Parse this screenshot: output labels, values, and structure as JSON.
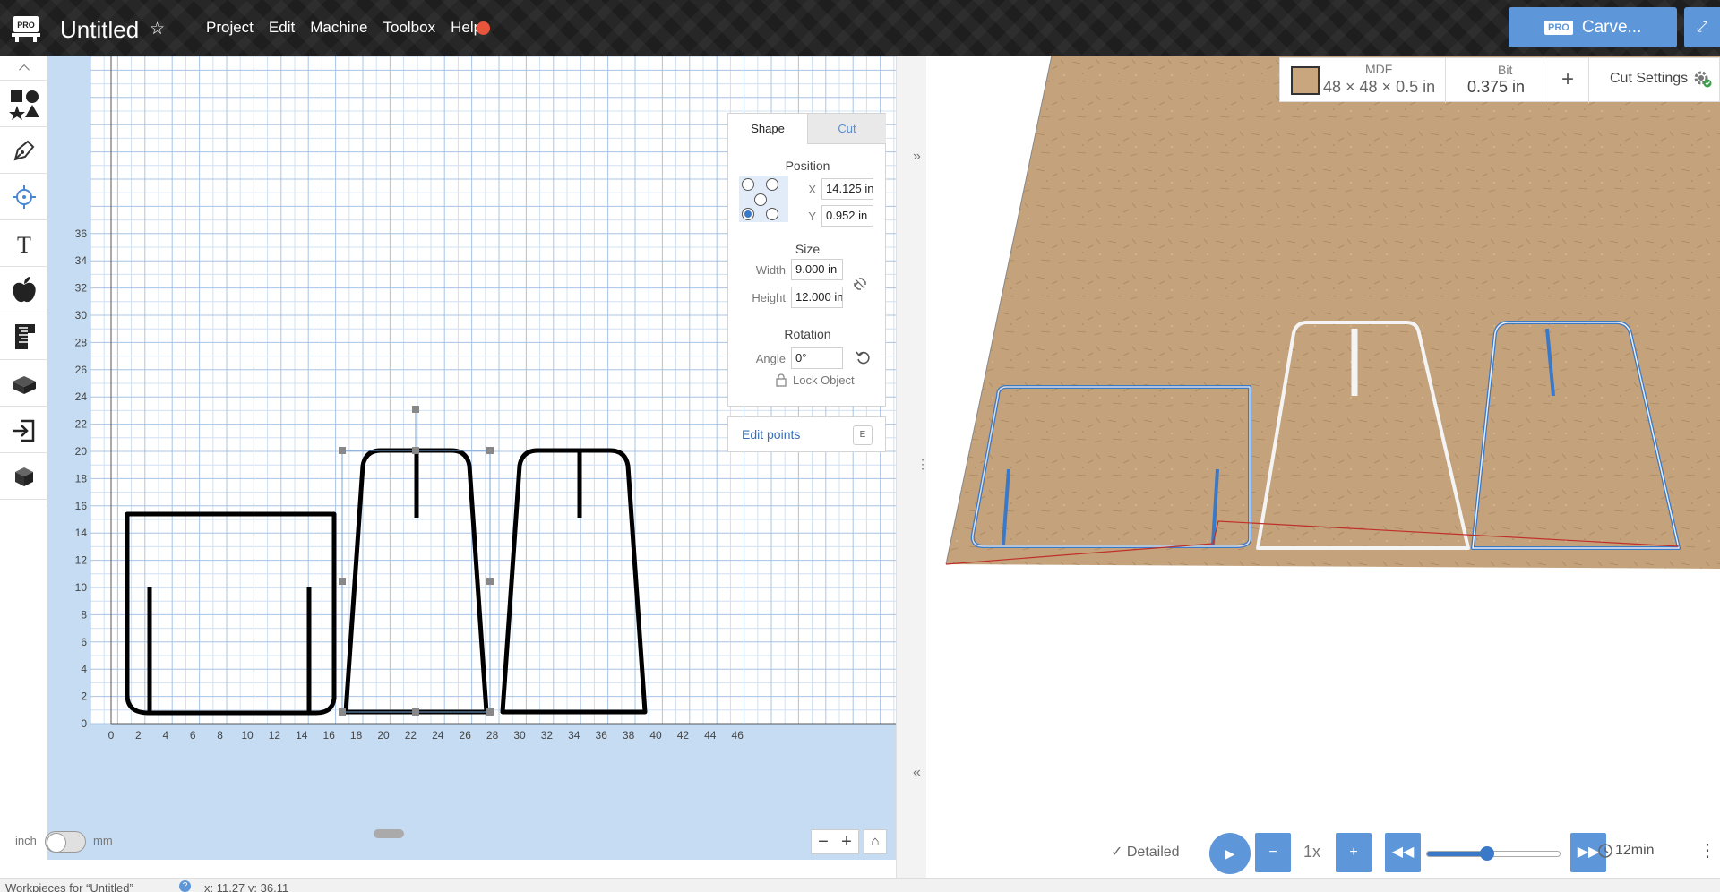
{
  "app": {
    "title": "Untitled"
  },
  "menu": [
    "Project",
    "Edit",
    "Machine",
    "Toolbox",
    "Help"
  ],
  "carve_button": {
    "badge": "PRO",
    "label": "Carve..."
  },
  "design": {
    "y_ticks": [
      "36",
      "34",
      "32",
      "30",
      "28",
      "26",
      "24",
      "22",
      "20",
      "18",
      "16",
      "14",
      "12",
      "10",
      "8",
      "6",
      "4",
      "2",
      "0"
    ],
    "x_ticks": [
      "0",
      "2",
      "4",
      "6",
      "8",
      "10",
      "12",
      "14",
      "16",
      "18",
      "20",
      "22",
      "24",
      "26",
      "28",
      "30",
      "32",
      "34",
      "36",
      "38",
      "40",
      "42",
      "44",
      "46"
    ]
  },
  "shape_panel": {
    "tabs": [
      "Shape",
      "Cut"
    ],
    "position_label": "Position",
    "x_label": "X",
    "x_value": "14.125 in",
    "y_label": "Y",
    "y_value": "0.952 in",
    "size_label": "Size",
    "width_label": "Width",
    "width_value": "9.000 in",
    "height_label": "Height",
    "height_value": "12.000 in",
    "rotation_label": "Rotation",
    "angle_label": "Angle",
    "angle_value": "0°",
    "lock_label": "Lock Object",
    "edit_points": "Edit points",
    "edit_points_key": "E"
  },
  "units": {
    "left": "inch",
    "right": "mm"
  },
  "material": {
    "name": "MDF",
    "dimensions": "48 × 48 × 0.5 in",
    "bit_label": "Bit",
    "bit_value": "0.375 in",
    "cut_settings": "Cut Settings",
    "swatch_color": "#c9a67d"
  },
  "player": {
    "detailed": "Detailed",
    "speed": "1x",
    "time": "12min",
    "progress": 0.45
  },
  "status": {
    "workpieces": "Workpieces for “Untitled”",
    "coords": "x: 11.27 y: 36.11"
  },
  "colors": {
    "accent": "#5d96d9",
    "canvas_bg": "#c6dcf2",
    "record_dot": "#e8543c"
  }
}
